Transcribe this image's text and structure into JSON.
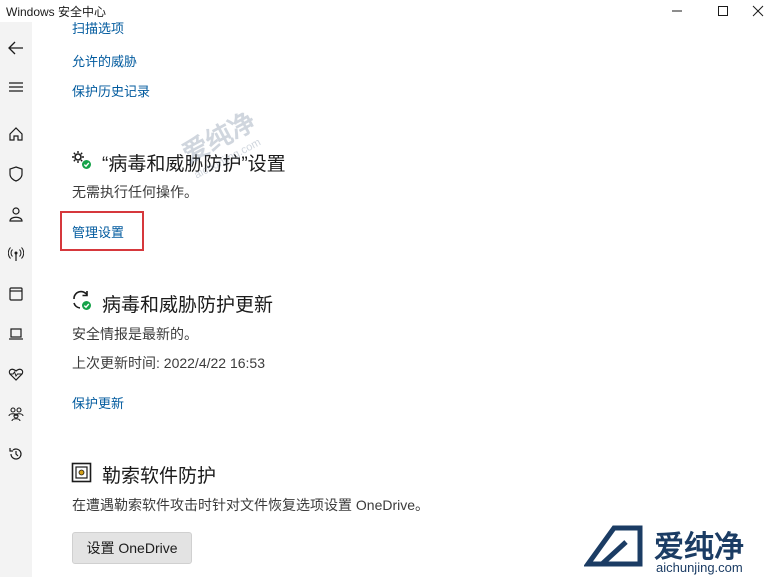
{
  "window": {
    "title": "Windows 安全中心",
    "controls": [
      "minimize-icon",
      "maximize-icon",
      "close-icon"
    ]
  },
  "nav": {
    "back_icon": "back-arrow-icon",
    "menu_icon": "hamburger-menu-icon",
    "items": [
      {
        "icon": "home-icon"
      },
      {
        "icon": "shield-icon"
      },
      {
        "icon": "account-icon"
      },
      {
        "icon": "network-icon"
      },
      {
        "icon": "app-browser-icon"
      },
      {
        "icon": "device-security-icon"
      },
      {
        "icon": "health-heart-icon"
      },
      {
        "icon": "family-icon"
      },
      {
        "icon": "history-icon"
      }
    ]
  },
  "top_links": [
    "扫描选项",
    "允许的威胁",
    "保护历史记录"
  ],
  "settings_section": {
    "title": "“病毒和威胁防护”设置",
    "status": "无需执行任何操作。",
    "link": "管理设置"
  },
  "updates_section": {
    "title": "病毒和威胁防护更新",
    "status": "安全情报是最新的。",
    "last_update": "上次更新时间: 2022/4/22 16:53",
    "link": "保护更新"
  },
  "ransomware_section": {
    "title": "勒索软件防护",
    "description": "在遭遇勒索软件攻击时针对文件恢复选项设置 OneDrive。",
    "button": "设置 OneDrive"
  },
  "watermark": {
    "brand": "爱纯净",
    "url": "aichunjing.com"
  },
  "colors": {
    "link": "#005a9e",
    "rail": "#f3f3f3",
    "highlight": "#d6383c",
    "status_ok": "#16a34a"
  }
}
